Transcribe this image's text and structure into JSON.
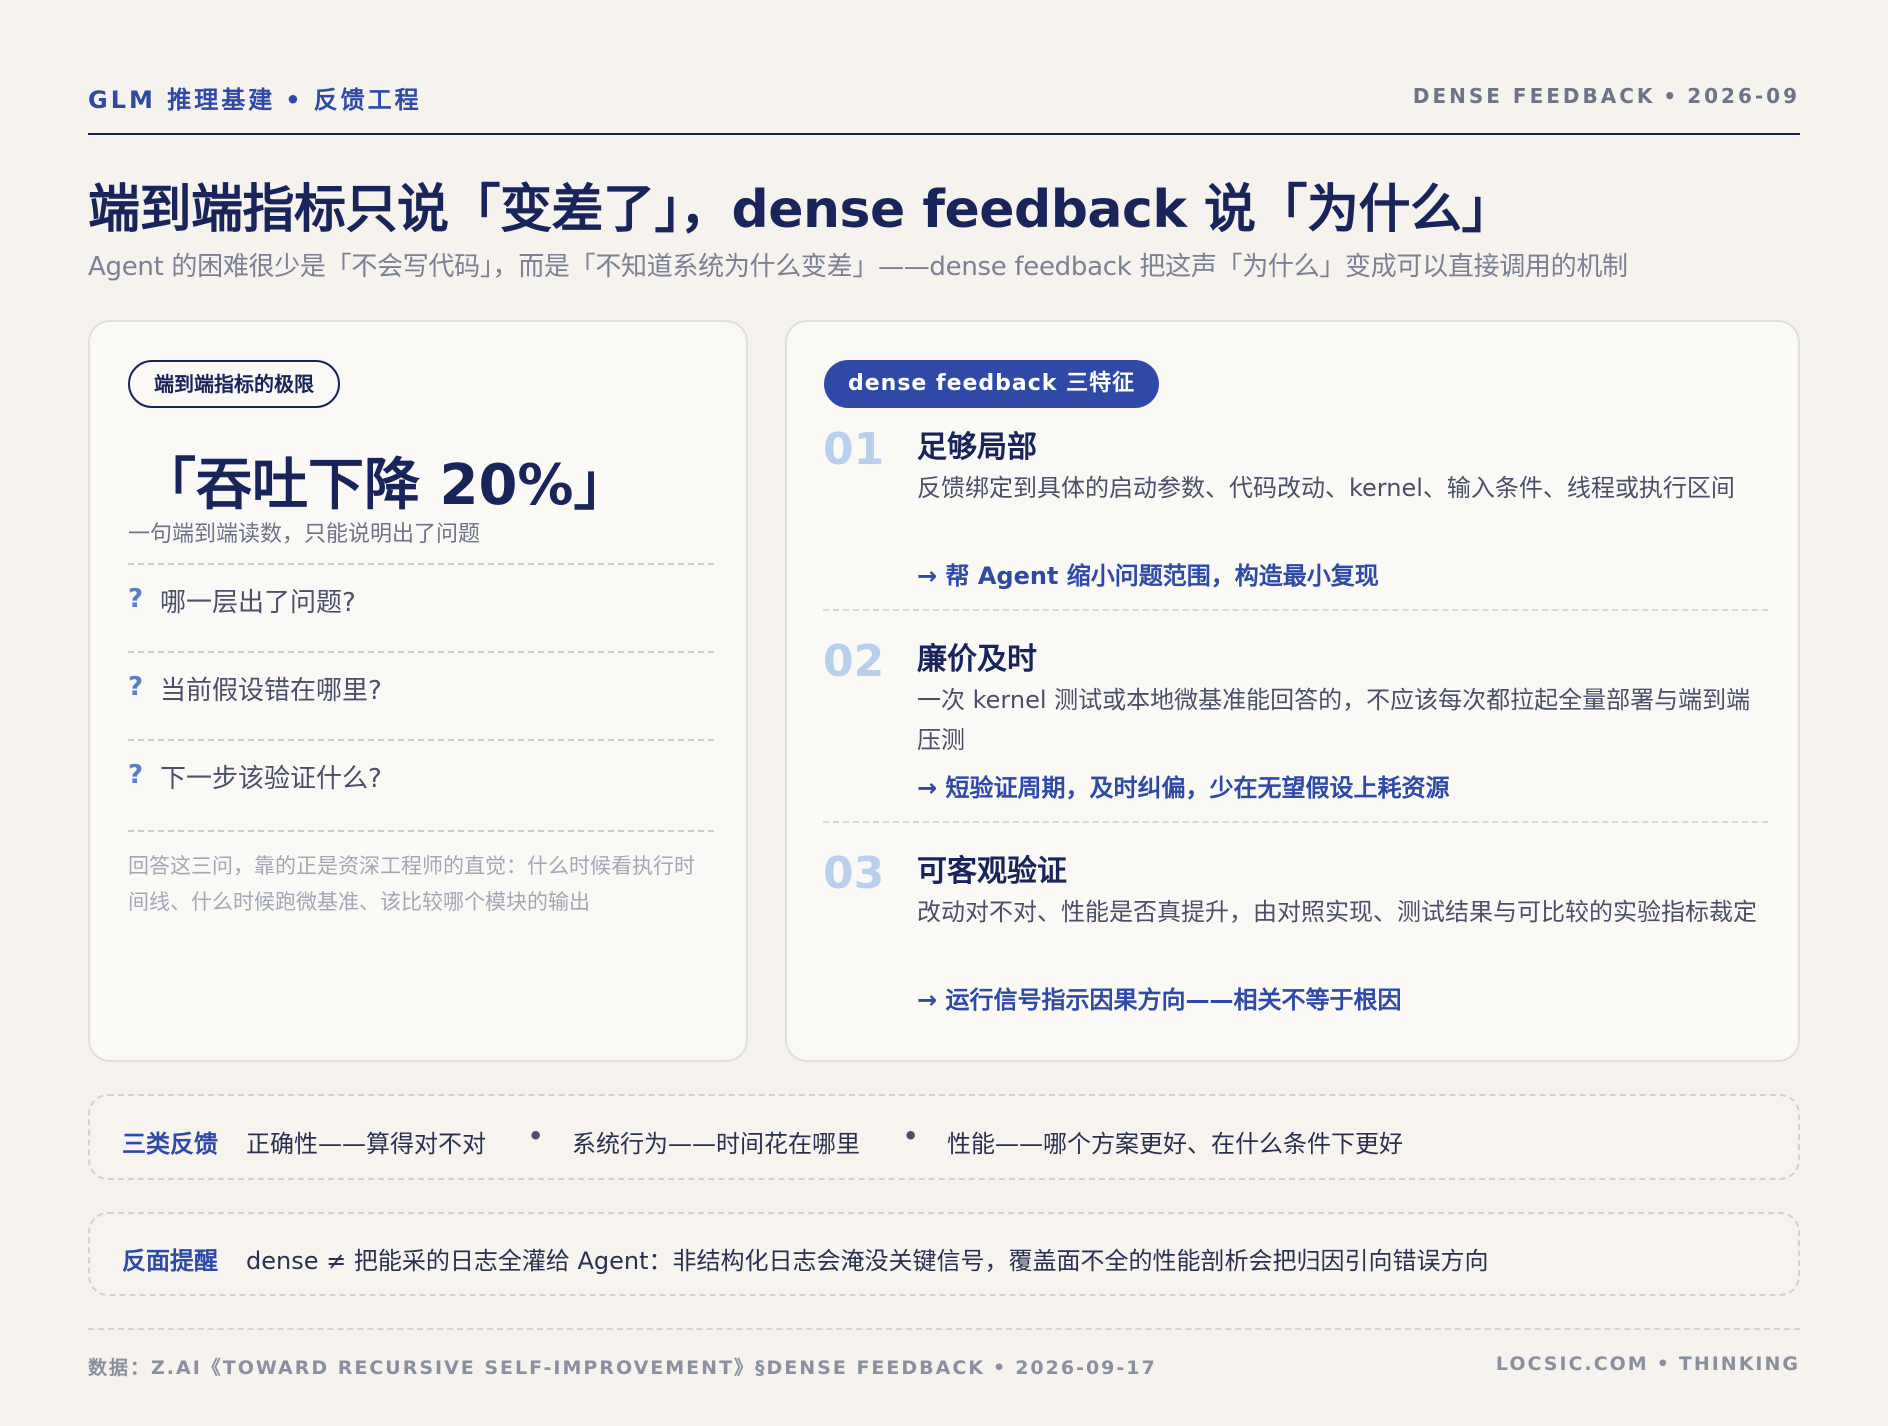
{
  "header": {
    "brand_left": "GLM 推理基建",
    "brand_right": "反馈工程",
    "edition_left": "DENSE FEEDBACK",
    "edition_right": "2026-09"
  },
  "title": "端到端指标只说「变差了」，dense feedback 说「为什么」",
  "subtitle": "Agent 的困难很少是「不会写代码」，而是「不知道系统为什么变差」——dense feedback 把这声「为什么」变成可以直接调用的机制",
  "left_card": {
    "pill": "端到端指标的极限",
    "big_quote": "「吞吐下降 20%」",
    "quote_note": "一句端到端读数，只能说明出了问题",
    "question_mark": "?",
    "questions": [
      "哪一层出了问题?",
      "当前假设错在哪里?",
      "下一步该验证什么?"
    ],
    "note": "回答这三问，靠的正是资深工程师的直觉：什么时候看执行时间线、什么时候跑微基准、该比较哪个模块的输出"
  },
  "right_card": {
    "pill": "dense feedback 三特征",
    "features": [
      {
        "num": "01",
        "title": "足够局部",
        "desc": "反馈绑定到具体的启动参数、代码改动、kernel、输入条件、线程或执行区间",
        "takeaway": "→ 帮 Agent 缩小问题范围，构造最小复现"
      },
      {
        "num": "02",
        "title": "廉价及时",
        "desc": "一次 kernel 测试或本地微基准能回答的，不应该每次都拉起全量部署与端到端压测",
        "takeaway": "→ 短验证周期，及时纠偏，少在无望假设上耗资源"
      },
      {
        "num": "03",
        "title": "可客观验证",
        "desc": "改动对不对、性能是否真提升，由对照实现、测试结果与可比较的实验指标裁定",
        "takeaway": "→ 运行信号指示因果方向——相关不等于根因"
      }
    ]
  },
  "banner_types": {
    "label": "三类反馈",
    "items": [
      "正确性——算得对不对",
      "系统行为——时间花在哪里",
      "性能——哪个方案更好、在什么条件下更好"
    ],
    "separator": "•"
  },
  "banner_warning": {
    "label": "反面提醒",
    "text": "dense ≠ 把能采的日志全灌给 Agent：非结构化日志会淹没关键信号，覆盖面不全的性能剖析会把归因引向错误方向"
  },
  "footer": {
    "source": "数据：Z.AI《TOWARD RECURSIVE SELF-IMPROVEMENT》§DENSE FEEDBACK",
    "date": "2026-09-17",
    "site": "LOCSIC.COM",
    "section": "THINKING"
  }
}
